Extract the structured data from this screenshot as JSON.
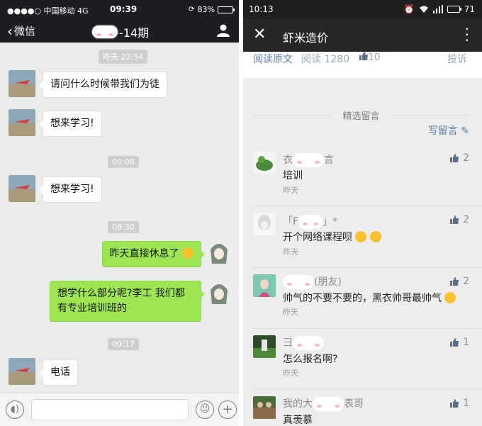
{
  "left": {
    "status": {
      "carrier": "●●●●○ 中国移动  4G",
      "time": "09:39",
      "battery": "83%"
    },
    "nav": {
      "back_label": "微信",
      "title": "-14期"
    },
    "messages": [
      {
        "type": "time",
        "text": "昨天 22:54"
      },
      {
        "type": "in",
        "text": "请问什么时候带我们为徒"
      },
      {
        "type": "in",
        "text": "想来学习!"
      },
      {
        "type": "time",
        "text": "00:08"
      },
      {
        "type": "in",
        "text": "想来学习!"
      },
      {
        "type": "time",
        "text": "08:30"
      },
      {
        "type": "out",
        "text": "昨天直接休息了"
      },
      {
        "type": "out",
        "line1": "想学什么部分呢?李工  我们都",
        "line2": "有专业培训班的"
      },
      {
        "type": "time",
        "text": "09:17"
      },
      {
        "type": "in",
        "text": "电话"
      }
    ]
  },
  "right": {
    "status": {
      "time": "10:13",
      "battery": "71"
    },
    "nav": {
      "title": "虾米造价"
    },
    "article": {
      "read_original": "阅读原文",
      "reads": "阅读 1280",
      "likes": "10",
      "report": "投诉"
    },
    "section_title": "精选留言",
    "write_comment": "写留言",
    "comments": [
      {
        "name": "衣",
        "name_tail": "言",
        "text": "培训",
        "date": "昨天",
        "likes": "2"
      },
      {
        "name": "「F",
        "name_tail": "」*",
        "text": "开个网络课程呗",
        "date": "昨天",
        "likes": "2"
      },
      {
        "name": "",
        "name_tail": "(朋友)",
        "text": "帅气的不要不要的，黑衣帅哥最帅气",
        "date": "昨天",
        "likes": "2"
      },
      {
        "name": "彐",
        "name_tail": "",
        "text": "怎么报名啊?",
        "date": "昨天",
        "likes": "1"
      },
      {
        "name": "我的大",
        "name_tail": "表哥",
        "text": "真羡慕",
        "date": "",
        "likes": "1"
      }
    ]
  }
}
